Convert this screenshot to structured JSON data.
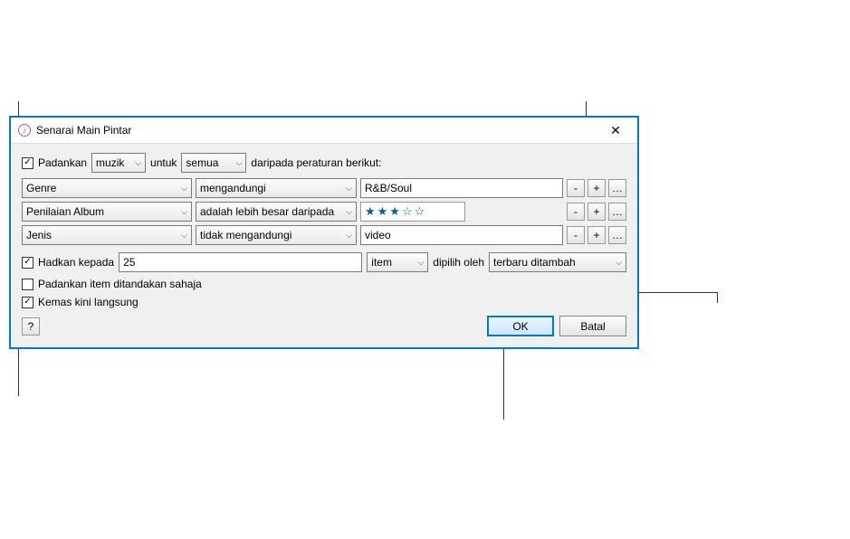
{
  "titlebar": {
    "title": "Senarai Main Pintar"
  },
  "match": {
    "label": "Padankan",
    "media": "muzik",
    "for_label": "untuk",
    "scope": "semua",
    "suffix": "daripada peraturan berikut:"
  },
  "rules": [
    {
      "field": "Genre",
      "op": "mengandungi",
      "value": "R&B/Soul"
    },
    {
      "field": "Penilaian Album",
      "op": "adalah lebih besar daripada",
      "value": "★★★☆☆"
    },
    {
      "field": "Jenis",
      "op": "tidak mengandungi",
      "value": "video"
    }
  ],
  "limit": {
    "label": "Hadkan kepada",
    "count": "25",
    "unit": "item",
    "selected_by_label": "dipilih oleh",
    "selected_by": "terbaru ditambah"
  },
  "checked_only": {
    "label": "Padankan item ditandakan sahaja"
  },
  "live_update": {
    "label": "Kemas kini langsung"
  },
  "buttons": {
    "help": "?",
    "ok": "OK",
    "cancel": "Batal",
    "minus": "-",
    "plus": "+",
    "more": "…"
  }
}
